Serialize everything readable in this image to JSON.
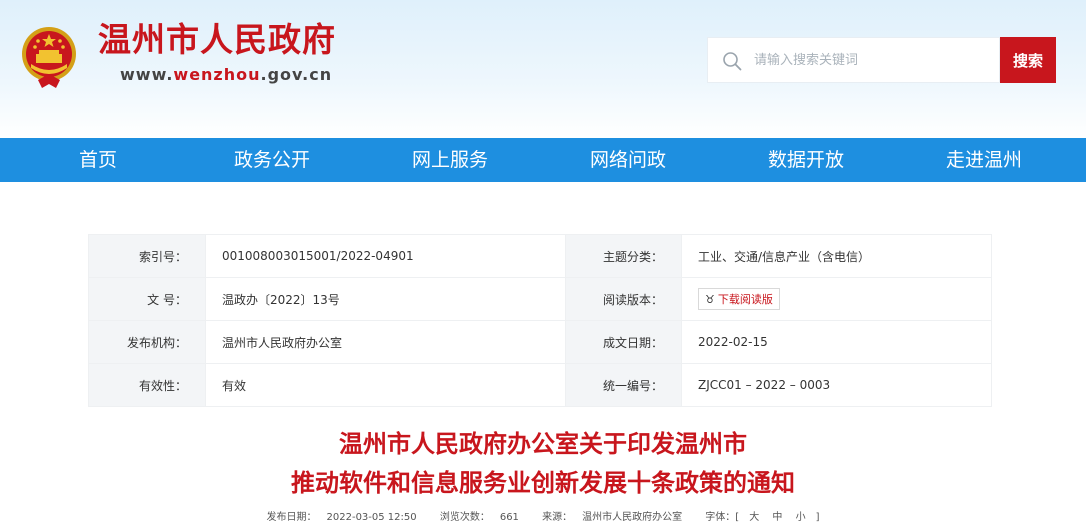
{
  "header": {
    "site_title": "温州市人民政府",
    "url_prefix": "www.",
    "url_accent": "wenzhou",
    "url_suffix": ".gov.cn",
    "search_placeholder": "请输入搜索关键词",
    "search_button": "搜索",
    "brand_color": "#c8161d"
  },
  "nav": {
    "items": [
      "首页",
      "政务公开",
      "网上服务",
      "网络问政",
      "数据开放",
      "走进温州"
    ],
    "color": "#1e8fe0"
  },
  "info": {
    "index_label": "索引号：",
    "index_value": "001008003015001/2022-04901",
    "topic_label": "主题分类：",
    "topic_value": "工业、交通/信息产业（含电信）",
    "docno_label": "文 号：",
    "docno_value": "温政办〔2022〕13号",
    "reader_label": "阅读版本：",
    "reader_value": "下载阅读版",
    "org_label": "发布机构：",
    "org_value": "温州市人民政府办公室",
    "date_label": "成文日期：",
    "date_value": "2022-02-15",
    "valid_label": "有效性：",
    "valid_value": "有效",
    "serial_label": "统一编号：",
    "serial_value": "ZJCC01 – 2022 – 0003"
  },
  "document": {
    "title_line1": "温州市人民政府办公室关于印发温州市",
    "title_line2": "推动软件和信息服务业创新发展十条政策的通知"
  },
  "meta": {
    "publish_label": "发布日期：",
    "publish_value": "2022-03-05 12:50",
    "views_label": "浏览次数：",
    "views_value": "661",
    "source_label": "来源：",
    "source_value": "温州市人民政府办公室",
    "font_label": "字体：[",
    "font_large": "大",
    "font_medium": "中",
    "font_small": "小",
    "font_close": "]"
  }
}
